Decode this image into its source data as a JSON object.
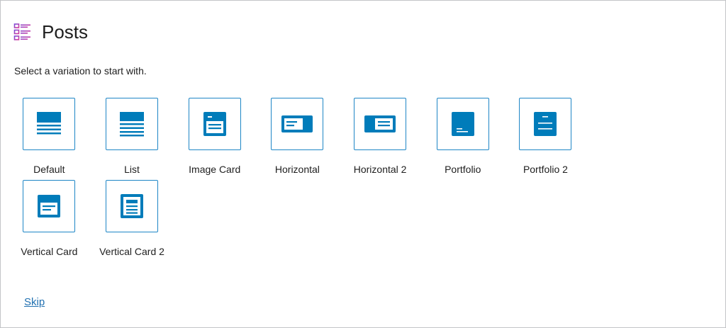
{
  "header": {
    "icon": "posts-list-icon",
    "title": "Posts"
  },
  "instructions": "Select a variation to start with.",
  "variations": [
    {
      "label": "Default",
      "icon": "default-layout-icon"
    },
    {
      "label": "List",
      "icon": "list-layout-icon"
    },
    {
      "label": "Image Card",
      "icon": "image-card-layout-icon"
    },
    {
      "label": "Horizontal",
      "icon": "horizontal-layout-icon"
    },
    {
      "label": "Horizontal 2",
      "icon": "horizontal-2-layout-icon"
    },
    {
      "label": "Portfolio",
      "icon": "portfolio-layout-icon"
    },
    {
      "label": "Portfolio 2",
      "icon": "portfolio-2-layout-icon"
    },
    {
      "label": "Vertical Card",
      "icon": "vertical-card-layout-icon"
    },
    {
      "label": "Vertical Card 2",
      "icon": "vertical-card-2-layout-icon"
    }
  ],
  "skip_label": "Skip",
  "colors": {
    "accent": "#007cba",
    "header_icon": "#9b3fc6",
    "link": "#2271b1"
  }
}
